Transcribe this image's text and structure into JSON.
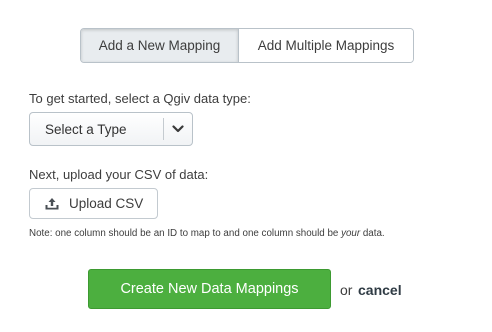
{
  "mode_toggle": {
    "active_label": "Add a New Mapping",
    "inactive_label": "Add Multiple Mappings"
  },
  "data_type": {
    "prompt": "To get started, select a Qgiv data type:",
    "selected": "Select a Type",
    "icon": "chevron-down-icon"
  },
  "upload": {
    "prompt": "Next, upload your CSV of data:",
    "button_label": "Upload CSV",
    "icon": "upload-icon"
  },
  "note": {
    "before": "Note: one column should be an ID to map to and one column should be ",
    "emphasis": "your",
    "after": " data."
  },
  "actions": {
    "primary_label": "Create New Data Mappings",
    "or_text": "or",
    "cancel_label": "cancel",
    "primary_color": "#4caf3f"
  }
}
